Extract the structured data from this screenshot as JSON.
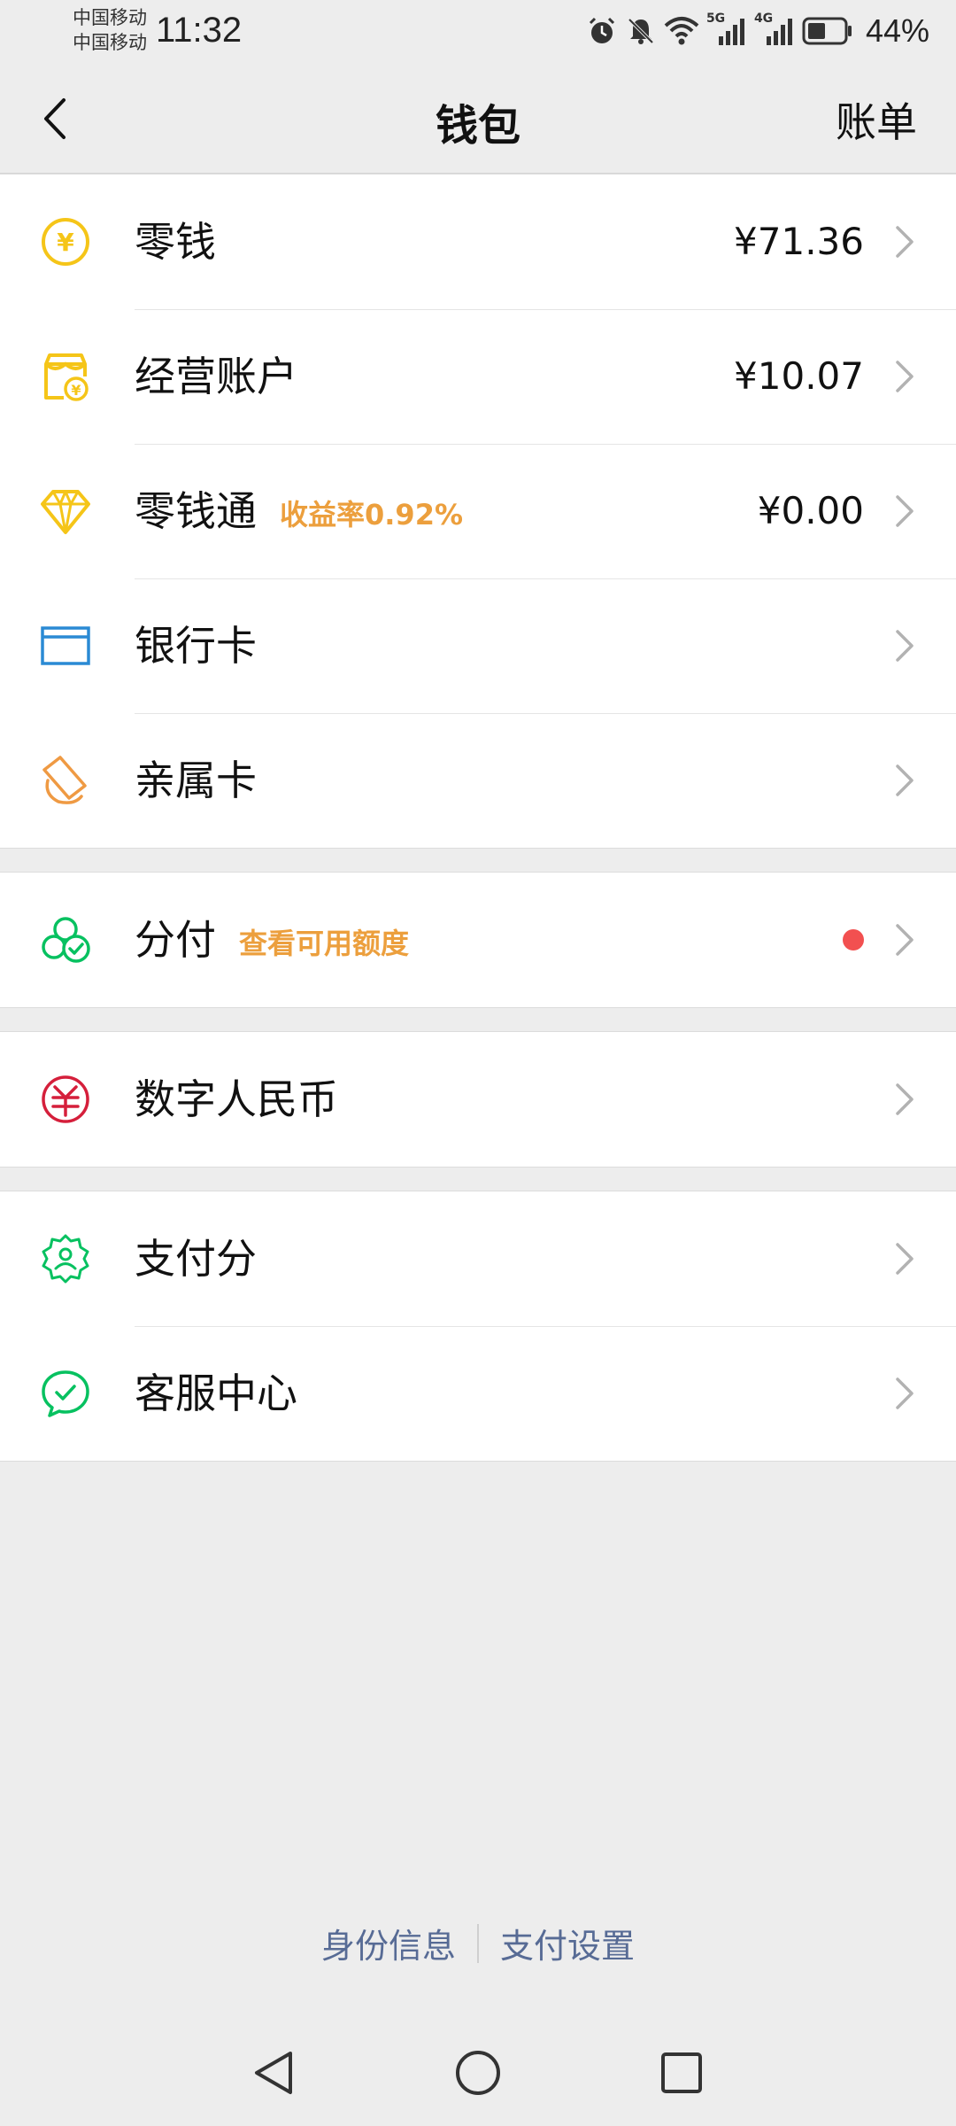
{
  "status_bar": {
    "carrier_1": "中国移动",
    "carrier_2": "中国移动",
    "time": "11:32",
    "signal_1_label": "5G",
    "signal_2_label": "4G",
    "battery": "44%"
  },
  "nav": {
    "title": "钱包",
    "action": "账单"
  },
  "groups": [
    {
      "rows": [
        {
          "label": "零钱",
          "value": "¥71.36",
          "icon": "coin-icon",
          "color": "#f5c518"
        },
        {
          "label": "经营账户",
          "value": "¥10.07",
          "icon": "shop-icon",
          "color": "#f5c518"
        },
        {
          "label": "零钱通",
          "tag": "收益率0.92%",
          "value": "¥0.00",
          "icon": "diamond-icon",
          "color": "#f5c518"
        },
        {
          "label": "银行卡",
          "icon": "bank-card-icon",
          "color": "#2a8ad4"
        },
        {
          "label": "亲属卡",
          "icon": "family-card-icon",
          "color": "#ef9a43"
        }
      ]
    },
    {
      "rows": [
        {
          "label": "分付",
          "tag": "查看可用额度",
          "icon": "fenfu-icon",
          "color": "#07c160",
          "dot_color": "#f25050"
        }
      ]
    },
    {
      "rows": [
        {
          "label": "数字人民币",
          "icon": "digital-rmb-icon",
          "color": "#d51f3b"
        }
      ]
    },
    {
      "rows": [
        {
          "label": "支付分",
          "icon": "pay-score-icon",
          "color": "#07c160"
        },
        {
          "label": "客服中心",
          "icon": "customer-service-icon",
          "color": "#07c160"
        }
      ]
    }
  ],
  "footer": {
    "link_1": "身份信息",
    "link_2": "支付设置"
  }
}
